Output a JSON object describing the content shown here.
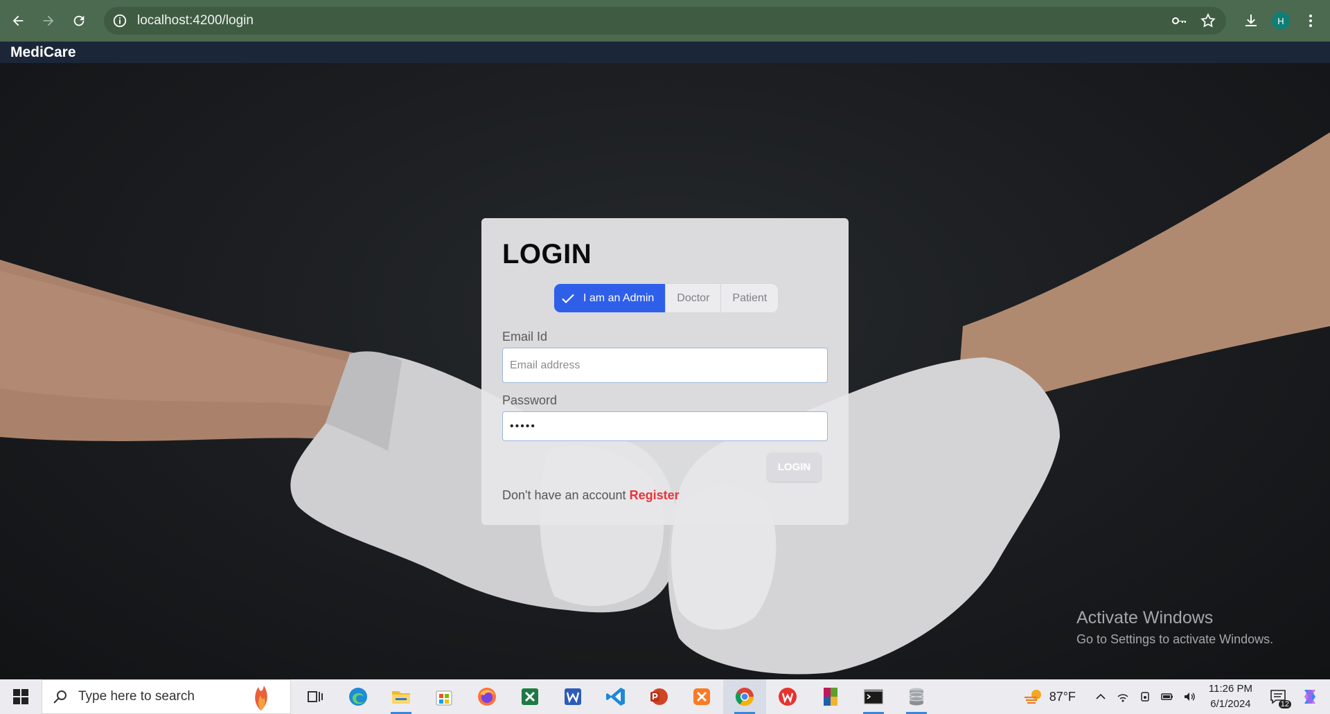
{
  "browser": {
    "url": "localhost:4200/login",
    "profile_initial": "H",
    "icons": [
      "back-icon",
      "forward-icon",
      "reload-icon",
      "site-info-icon",
      "password-key-icon",
      "bookmark-star-icon",
      "download-icon",
      "menu-kebab-icon"
    ]
  },
  "app": {
    "brand": "MediCare"
  },
  "login": {
    "title": "LOGIN",
    "roles": [
      {
        "label": "I am an Admin",
        "selected": true
      },
      {
        "label": "Doctor",
        "selected": false
      },
      {
        "label": "Patient",
        "selected": false
      }
    ],
    "email_label": "Email Id",
    "email_placeholder": "Email address",
    "email_value": "",
    "password_label": "Password",
    "password_value": "•••••",
    "submit_label": "LOGIN",
    "register_prompt": "Don't have an account",
    "register_link": "Register"
  },
  "watermark": {
    "title": "Activate Windows",
    "subtitle": "Go to Settings to activate Windows."
  },
  "taskbar": {
    "search_placeholder": "Type here to search",
    "weather": "87°F",
    "time": "11:26 PM",
    "date": "6/1/2024",
    "notification_count": "12",
    "apps": [
      "task-view-icon",
      "edge-icon",
      "file-explorer-icon",
      "store-icon",
      "firefox-icon",
      "excel-icon",
      "word-icon",
      "vscode-icon",
      "powerpoint-icon",
      "xampp-icon",
      "chrome-icon",
      "wps-icon",
      "winrar-icon",
      "terminal-icon",
      "database-icon"
    ]
  },
  "colors": {
    "browser_bar": "#4b6a4f",
    "app_header": "#1b2739",
    "accent": "#2f5fe8",
    "register": "#e8343d"
  }
}
